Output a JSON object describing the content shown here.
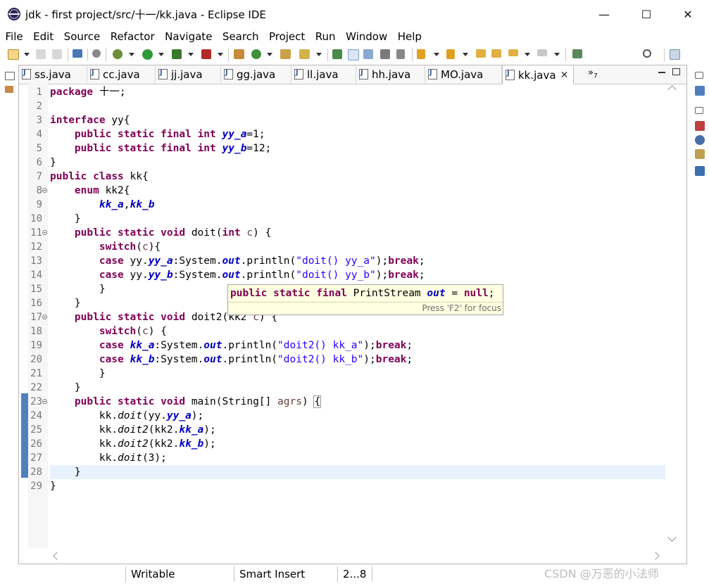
{
  "window": {
    "title": "jdk - first project/src/十一/kk.java - Eclipse IDE",
    "minimize": "—",
    "maximize": "☐",
    "close": "✕"
  },
  "menu": [
    "File",
    "Edit",
    "Source",
    "Refactor",
    "Navigate",
    "Search",
    "Project",
    "Run",
    "Window",
    "Help"
  ],
  "tabs": [
    {
      "label": "ss.java",
      "active": false
    },
    {
      "label": "cc.java",
      "active": false
    },
    {
      "label": "jj.java",
      "active": false
    },
    {
      "label": "gg.java",
      "active": false
    },
    {
      "label": "ll.java",
      "active": false
    },
    {
      "label": "hh.java",
      "active": false
    },
    {
      "label": "MO.java",
      "active": false
    },
    {
      "label": "kk.java",
      "active": true
    }
  ],
  "tab_close": "✕",
  "tab_overflow": "»",
  "tab_overflow_count": "7",
  "editor": {
    "line_numbers": [
      "1",
      "2",
      "3",
      "4",
      "5",
      "6",
      "7",
      "8",
      "9",
      "10",
      "11",
      "12",
      "13",
      "14",
      "15",
      "16",
      "17",
      "18",
      "19",
      "20",
      "21",
      "22",
      "23",
      "24",
      "25",
      "26",
      "27",
      "28",
      "29"
    ],
    "code_lines": [
      "package 十一;",
      "",
      "interface yy{",
      "    public static final int yy_a=1;",
      "    public static final int yy_b=12;",
      "}",
      "public class kk{",
      "    enum kk2{",
      "        kk_a,kk_b",
      "    }",
      "    public static void doit(int c) {",
      "        switch(c){",
      "        case yy.yy_a:System.out.println(\"doit() yy_a\");break;",
      "        case yy.yy_b:System.out.println(\"doit() yy_b\");break;",
      "        }",
      "    }",
      "    public static void doit2(kk2 c) {",
      "        switch(c) {",
      "        case kk_a:System.out.println(\"doit2() kk_a\");break;",
      "        case kk_b:System.out.println(\"doit2() kk_b\");break;",
      "        }",
      "    }",
      "    public static void main(String[] agrs) {",
      "        kk.doit(yy.yy_a);",
      "        kk.doit2(kk2.kk_a);",
      "        kk.doit2(kk2.kk_b);",
      "        kk.doit(3);",
      "    }",
      "}"
    ],
    "current_line": 28,
    "fold_lines": [
      8,
      11,
      17,
      23
    ]
  },
  "tooltip": {
    "signature": "public static final PrintStream out = null;",
    "hint": "Press 'F2' for focus"
  },
  "status": {
    "writable": "Writable",
    "insert_mode": "Smart Insert",
    "position": "2...8"
  },
  "watermark": "CSDN @万恶的小法师",
  "colors": {
    "keyword": "#7f0055",
    "field": "#0000c0",
    "string": "#2a00ff",
    "current_line": "#e8f2fe",
    "tooltip_bg": "#ffffe1"
  }
}
